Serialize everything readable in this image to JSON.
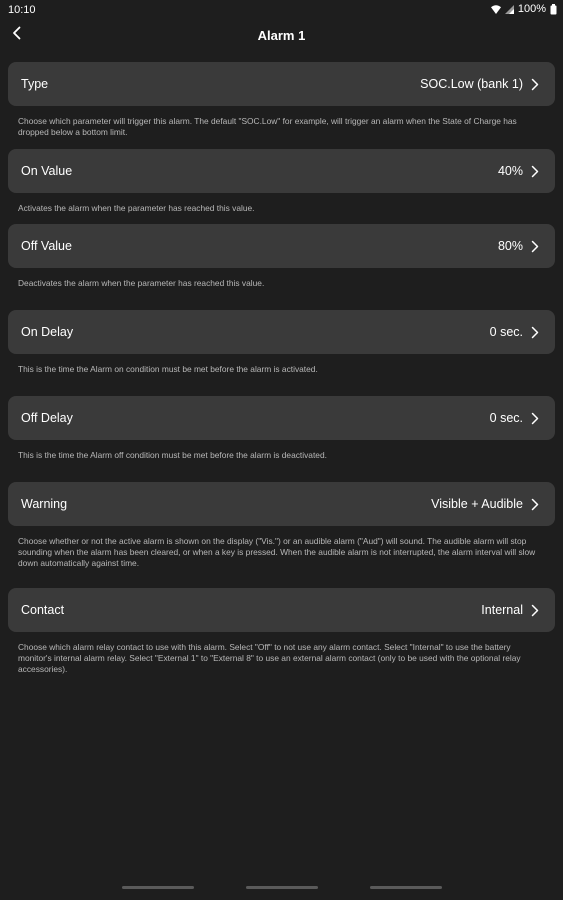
{
  "status_bar": {
    "time": "10:10",
    "battery": "100%"
  },
  "header": {
    "title": "Alarm 1"
  },
  "settings": [
    {
      "label": "Type",
      "value": "SOC.Low (bank 1)",
      "description": "Choose which parameter will trigger this alarm. The default \"SOC.Low\" for example, will trigger an alarm when the State of Charge has dropped below a bottom limit."
    },
    {
      "label": "On Value",
      "value": "40%",
      "description": "Activates the alarm when the parameter has reached this value."
    },
    {
      "label": "Off Value",
      "value": "80%",
      "description": "Deactivates the alarm when the parameter has reached this value."
    },
    {
      "label": "On Delay",
      "value": "0 sec.",
      "description": "This is the time the Alarm on condition must be met before the alarm is activated."
    },
    {
      "label": "Off Delay",
      "value": "0 sec.",
      "description": "This is the time the Alarm off condition must be met before the alarm is deactivated."
    },
    {
      "label": "Warning",
      "value": "Visible + Audible",
      "description": "Choose whether or not the active alarm is shown on the display (\"Vis.\") or an audible alarm (\"Aud\") will sound. The audible alarm will stop sounding when the alarm has been cleared, or when a key is pressed. When the audible alarm is not interrupted, the alarm interval will slow down automatically against time."
    },
    {
      "label": "Contact",
      "value": "Internal",
      "description": "Choose which alarm relay contact to use with this alarm. Select \"Off\" to not use any alarm contact. Select \"Internal\" to use the battery monitor's internal alarm relay. Select \"External 1\" to \"External 8\" to use an external alarm contact (only to be used with the optional relay accessories)."
    }
  ]
}
